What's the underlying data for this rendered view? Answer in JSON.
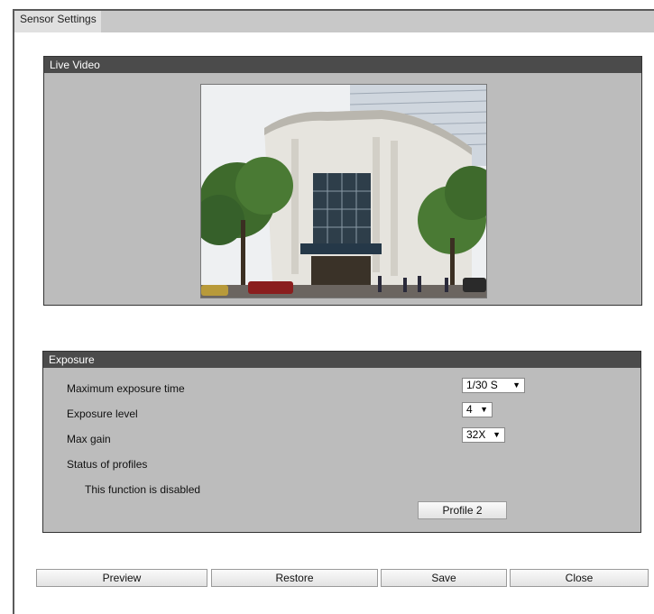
{
  "window": {
    "title": "Sensor Settings"
  },
  "live_video": {
    "header": "Live Video"
  },
  "exposure": {
    "header": "Exposure",
    "max_exposure_time_label": "Maximum exposure time",
    "max_exposure_time_value": "1/30 S",
    "exposure_level_label": "Exposure level",
    "exposure_level_value": "4",
    "max_gain_label": "Max gain",
    "max_gain_value": "32X",
    "status_profiles_label": "Status of profiles",
    "disabled_message": "This function is disabled",
    "profile_button": "Profile 2"
  },
  "actions": {
    "preview": "Preview",
    "restore": "Restore",
    "save": "Save",
    "close": "Close"
  },
  "icons": {
    "dropdown": "chevron-down-icon"
  }
}
